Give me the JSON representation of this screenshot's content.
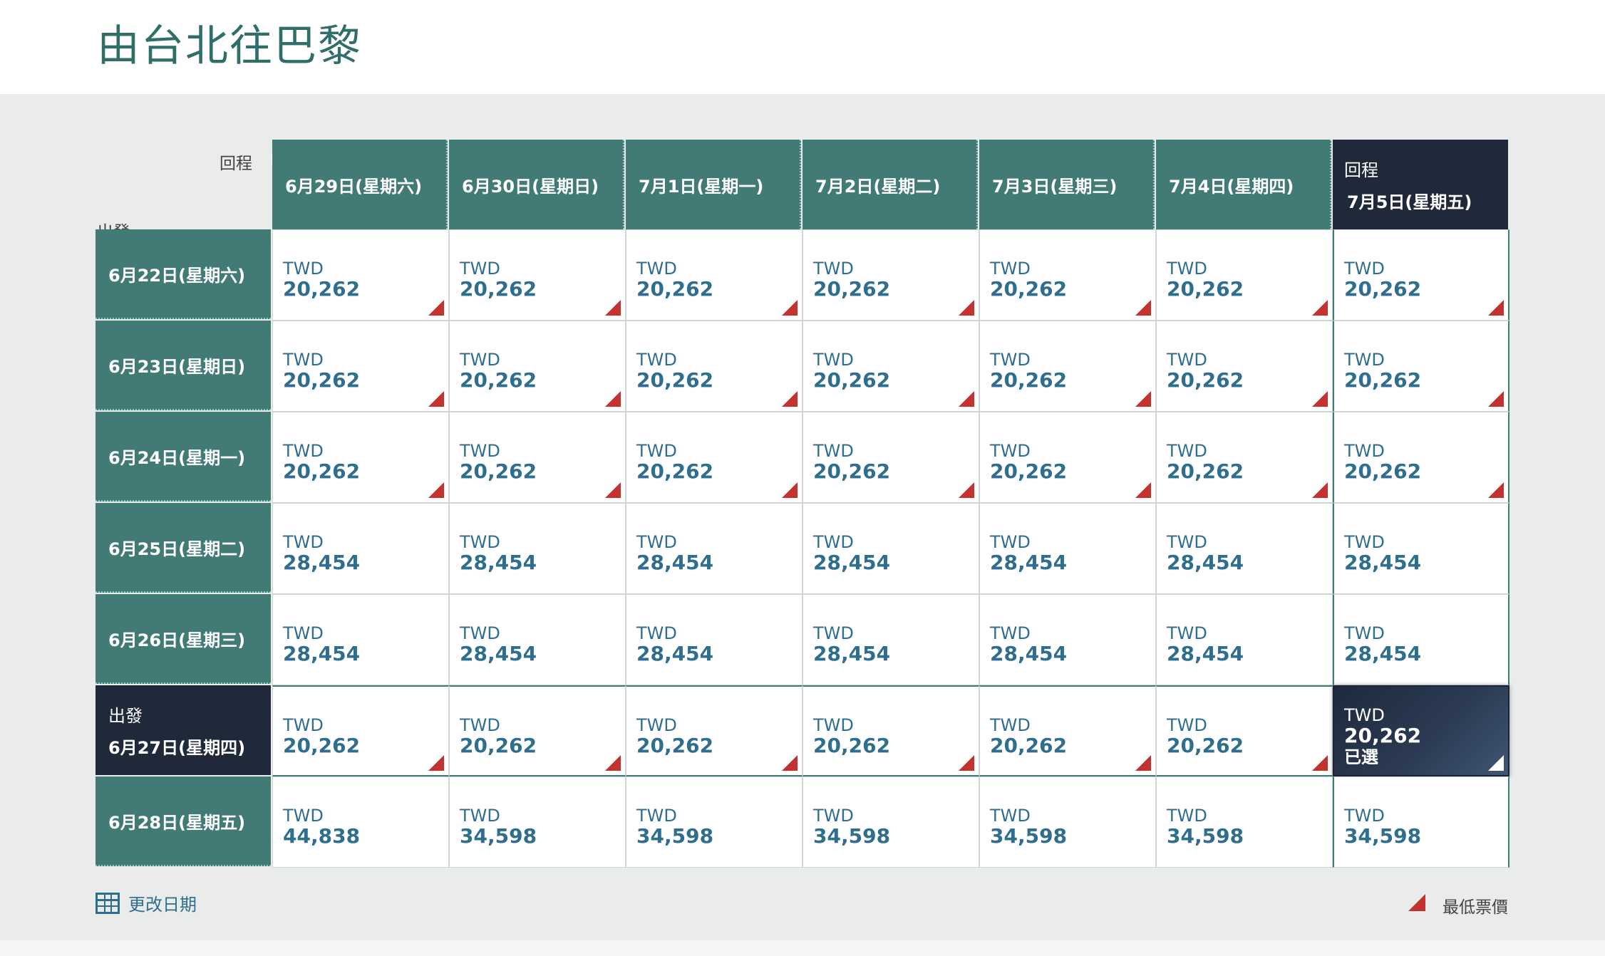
{
  "page": {
    "title": "由台北往巴黎"
  },
  "corner": {
    "return_label": "回程",
    "depart_label": "出發"
  },
  "currency": "TWD",
  "selected_label": "已選",
  "return_tag": "回程",
  "depart_tag": "出發",
  "columns": [
    "6月29日(星期六)",
    "6月30日(星期日)",
    "7月1日(星期一)",
    "7月2日(星期二)",
    "7月3日(星期三)",
    "7月4日(星期四)",
    "7月5日(星期五)"
  ],
  "selected_column": 6,
  "rows": [
    {
      "label": "6月22日(星期六)",
      "prices": [
        "20,262",
        "20,262",
        "20,262",
        "20,262",
        "20,262",
        "20,262",
        "20,262"
      ],
      "lowest": [
        true,
        true,
        true,
        true,
        true,
        true,
        true
      ]
    },
    {
      "label": "6月23日(星期日)",
      "prices": [
        "20,262",
        "20,262",
        "20,262",
        "20,262",
        "20,262",
        "20,262",
        "20,262"
      ],
      "lowest": [
        true,
        true,
        true,
        true,
        true,
        true,
        true
      ]
    },
    {
      "label": "6月24日(星期一)",
      "prices": [
        "20,262",
        "20,262",
        "20,262",
        "20,262",
        "20,262",
        "20,262",
        "20,262"
      ],
      "lowest": [
        true,
        true,
        true,
        true,
        true,
        true,
        true
      ]
    },
    {
      "label": "6月25日(星期二)",
      "prices": [
        "28,454",
        "28,454",
        "28,454",
        "28,454",
        "28,454",
        "28,454",
        "28,454"
      ],
      "lowest": [
        false,
        false,
        false,
        false,
        false,
        false,
        false
      ]
    },
    {
      "label": "6月26日(星期三)",
      "prices": [
        "28,454",
        "28,454",
        "28,454",
        "28,454",
        "28,454",
        "28,454",
        "28,454"
      ],
      "lowest": [
        false,
        false,
        false,
        false,
        false,
        false,
        false
      ]
    },
    {
      "label": "6月27日(星期四)",
      "prices": [
        "20,262",
        "20,262",
        "20,262",
        "20,262",
        "20,262",
        "20,262",
        "20,262"
      ],
      "lowest": [
        true,
        true,
        true,
        true,
        true,
        true,
        true
      ]
    },
    {
      "label": "6月28日(星期五)",
      "prices": [
        "44,838",
        "34,598",
        "34,598",
        "34,598",
        "34,598",
        "34,598",
        "34,598"
      ],
      "lowest": [
        false,
        false,
        false,
        false,
        false,
        false,
        false
      ]
    }
  ],
  "selected_row": 5,
  "footer": {
    "change_date": "更改日期",
    "legend_label": "最低票價"
  },
  "colors": {
    "header_teal": "#427a76",
    "selected_navy": "#20293a",
    "price_blue": "#2f6e8f",
    "lowest_marker_red": "#c0332f"
  }
}
